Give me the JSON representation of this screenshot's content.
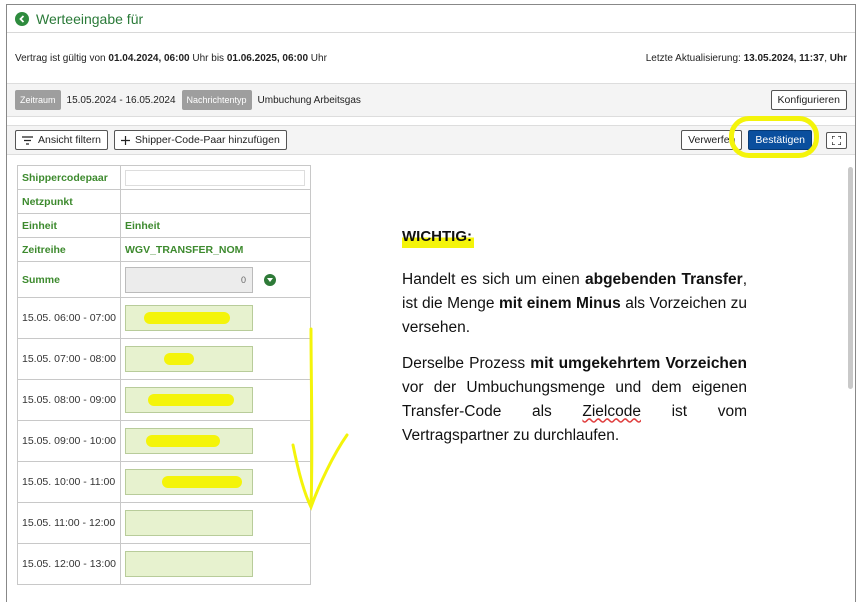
{
  "header": {
    "title": "Werteeingabe für"
  },
  "validity": {
    "prefix": "Vertrag ist gültig von",
    "from": "01.04.2024, 06:00",
    "mid": "Uhr bis",
    "to": "01.06.2025, 06:00",
    "suffix": "Uhr",
    "updated_label": "Letzte Aktualisierung:",
    "updated_value": "13.05.2024, 11:37",
    "updated_suffix": "Uhr"
  },
  "info": {
    "period_tag": "Zeitraum",
    "period_value": "15.05.2024 - 16.05.2024",
    "msgtype_tag": "Nachrichtentyp",
    "msgtype_value": "Umbuchung Arbeitsgas",
    "configure": "Konfigurieren"
  },
  "toolbar": {
    "filter": "Ansicht filtern",
    "add_pair": "Shipper-Code-Paar hinzufügen",
    "discard": "Verwerfen",
    "confirm": "Bestätigen"
  },
  "grid": {
    "shipper_label": "Shippercodepaar",
    "netpoint_label": "Netzpunkt",
    "unit_label": "Einheit",
    "unit_value": "Einheit",
    "series_label": "Zeitreihe",
    "series_value": "WGV_TRANSFER_NOM",
    "sum_label": "Summe",
    "sum_value": "0",
    "rows": [
      "15.05. 06:00 - 07:00",
      "15.05. 07:00 - 08:00",
      "15.05. 08:00 - 09:00",
      "15.05. 09:00 - 10:00",
      "15.05. 10:00 - 11:00",
      "15.05. 11:00 - 12:00",
      "15.05. 12:00 - 13:00"
    ]
  },
  "note": {
    "heading": "WICHTIG:",
    "p1_a": "Handelt es sich um einen ",
    "p1_b": "abgebenden Transfer",
    "p1_c": ", ist die Menge ",
    "p1_d": "mit einem Minus",
    "p1_e": " als Vorzeichen zu versehen.",
    "p2_a": "Derselbe Prozess ",
    "p2_b": "mit umgekehrtem Vorzeichen",
    "p2_c": " vor der Umbuchungsmenge und dem eigenen Transfer-Code als ",
    "p2_d": "Zielcode",
    "p2_e": " ist vom Vertragspartner zu durchlaufen."
  },
  "colors": {
    "accent_green": "#3d8a2e",
    "primary_blue": "#0a4f9e",
    "marker_yellow": "#f4f40a"
  }
}
